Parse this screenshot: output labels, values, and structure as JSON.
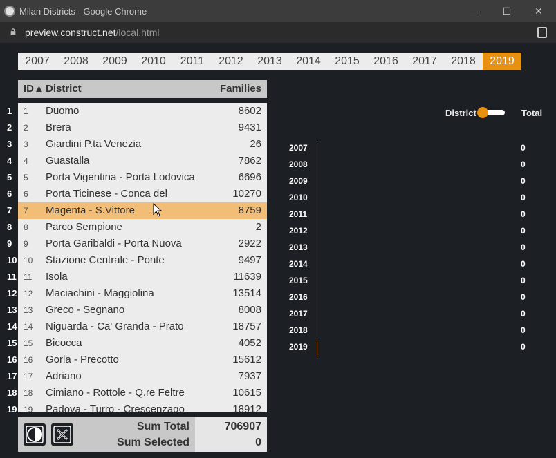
{
  "window": {
    "title": "Milan Districts - Google Chrome",
    "url_host": "preview.construct.net",
    "url_path": "/local.html"
  },
  "years": [
    "2007",
    "2008",
    "2009",
    "2010",
    "2011",
    "2012",
    "2013",
    "2014",
    "2015",
    "2016",
    "2017",
    "2018",
    "2019"
  ],
  "active_year": "2019",
  "table": {
    "header_id": "ID▲",
    "header_district": "District",
    "header_families": "Families",
    "rows": [
      {
        "num": "1",
        "id": "1",
        "district": "Duomo",
        "families": "8602"
      },
      {
        "num": "2",
        "id": "2",
        "district": "Brera",
        "families": "9431"
      },
      {
        "num": "3",
        "id": "3",
        "district": "Giardini P.ta Venezia",
        "families": "26"
      },
      {
        "num": "4",
        "id": "4",
        "district": "Guastalla",
        "families": "7862"
      },
      {
        "num": "5",
        "id": "5",
        "district": "Porta Vigentina - Porta Lodovica",
        "families": "6696"
      },
      {
        "num": "6",
        "id": "6",
        "district": "Porta Ticinese - Conca del",
        "families": "10270"
      },
      {
        "num": "7",
        "id": "7",
        "district": "Magenta - S.Vittore",
        "families": "8759"
      },
      {
        "num": "8",
        "id": "8",
        "district": "Parco Sempione",
        "families": "2"
      },
      {
        "num": "9",
        "id": "9",
        "district": "Porta Garibaldi - Porta Nuova",
        "families": "2922"
      },
      {
        "num": "10",
        "id": "10",
        "district": "Stazione Centrale - Ponte",
        "families": "9497"
      },
      {
        "num": "11",
        "id": "11",
        "district": "Isola",
        "families": "11639"
      },
      {
        "num": "12",
        "id": "12",
        "district": "Maciachini - Maggiolina",
        "families": "13514"
      },
      {
        "num": "13",
        "id": "13",
        "district": "Greco - Segnano",
        "families": "8008"
      },
      {
        "num": "14",
        "id": "14",
        "district": "Niguarda - Ca' Granda - Prato",
        "families": "18757"
      },
      {
        "num": "15",
        "id": "15",
        "district": "Bicocca",
        "families": "4052"
      },
      {
        "num": "16",
        "id": "16",
        "district": "Gorla - Precotto",
        "families": "15612"
      },
      {
        "num": "17",
        "id": "17",
        "district": "Adriano",
        "families": "7937"
      },
      {
        "num": "18",
        "id": "18",
        "district": "Cimiano - Rottole - Q.re Feltre",
        "families": "10615"
      },
      {
        "num": "19",
        "id": "19",
        "district": "Padova - Turro - Crescenzago",
        "families": "18912"
      }
    ],
    "selected_row_index": 6
  },
  "footer": {
    "sum_total_label": "Sum Total",
    "sum_total_value": "706907",
    "sum_selected_label": "Sum Selected",
    "sum_selected_value": "0"
  },
  "toggle": {
    "left_label": "District",
    "right_label": "Total",
    "state": "District"
  },
  "chart_data": {
    "type": "bar",
    "orientation": "horizontal",
    "categories": [
      "2007",
      "2008",
      "2009",
      "2010",
      "2011",
      "2012",
      "2013",
      "2014",
      "2015",
      "2016",
      "2017",
      "2018",
      "2019"
    ],
    "values": [
      0,
      0,
      0,
      0,
      0,
      0,
      0,
      0,
      0,
      0,
      0,
      0,
      0
    ],
    "highlight_category": "2019",
    "highlight_color": "#e8900f"
  },
  "colors": {
    "accent": "#e8900f",
    "selected_row": "#f2bd77",
    "background": "#1c1f24"
  }
}
